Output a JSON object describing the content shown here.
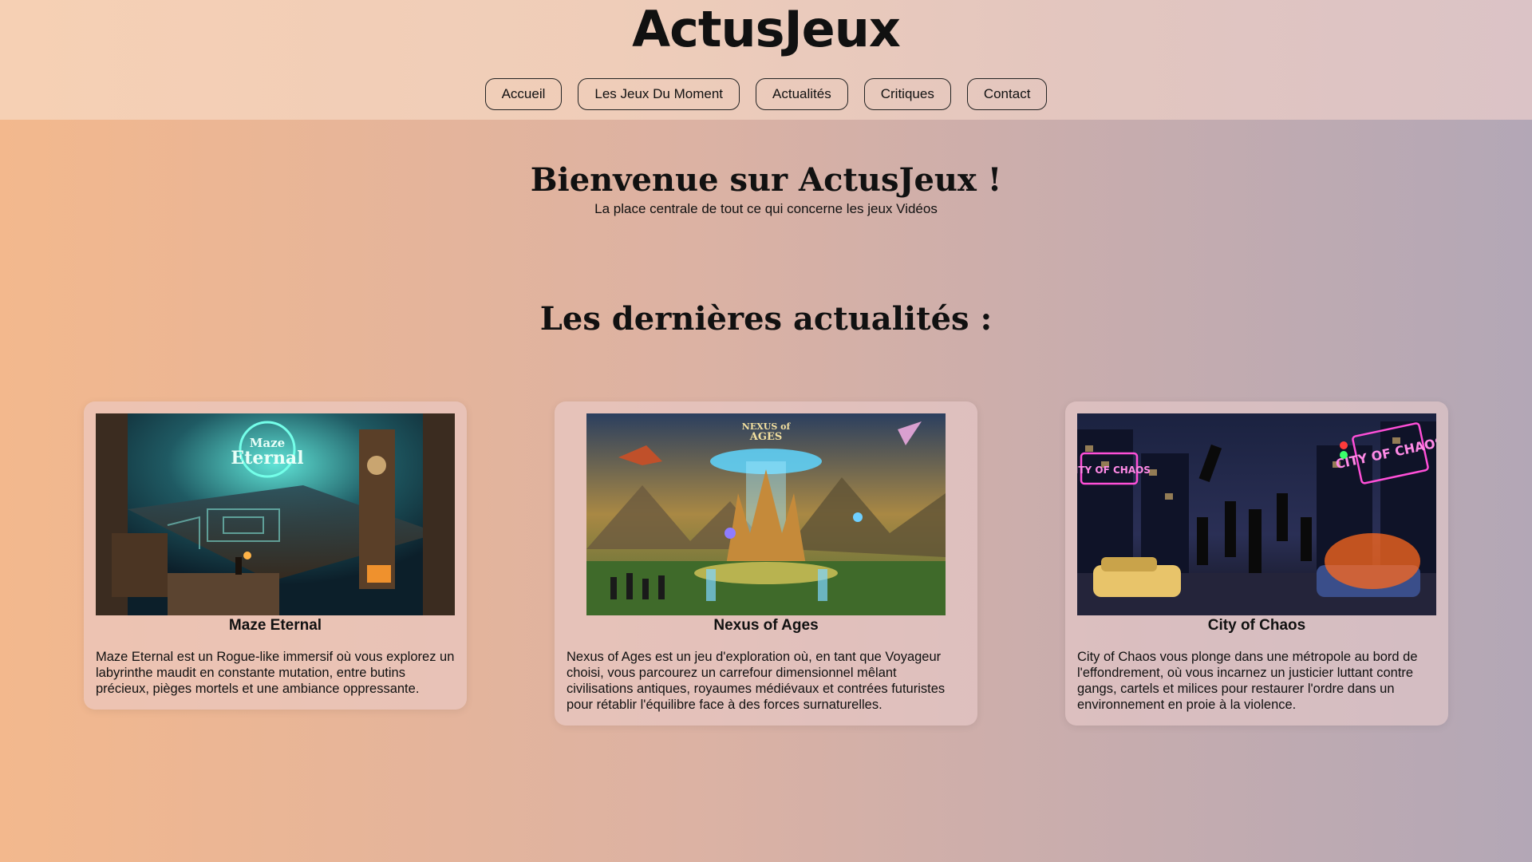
{
  "header": {
    "logo": "ActusJeux",
    "nav": [
      {
        "label": "Accueil"
      },
      {
        "label": "Les Jeux Du Moment"
      },
      {
        "label": "Actualités"
      },
      {
        "label": "Critiques"
      },
      {
        "label": "Contact"
      }
    ]
  },
  "hero": {
    "title": "Bienvenue sur ActusJeux !",
    "subtitle": "La place centrale de tout ce qui concerne les jeux Vidéos"
  },
  "news": {
    "title": "Les dernières actualités :",
    "cards": [
      {
        "name": "Maze Eternal",
        "image_logo_text": "Maze Eternal",
        "description": "Maze Eternal est un Rogue-like immersif où vous explorez un labyrinthe maudit en constante mutation, entre butins précieux, pièges mortels et une ambiance oppressante."
      },
      {
        "name": "Nexus of Ages",
        "image_logo_text": "Nexus of Ages",
        "description": "Nexus of Ages est un jeu d'exploration où, en tant que Voyageur choisi, vous parcourez un carrefour dimensionnel mêlant civilisations antiques, royaumes médiévaux et contrées futuristes pour rétablir l'équilibre face à des forces surnaturelles."
      },
      {
        "name": "City of Chaos",
        "image_logo_text": "City of Chaos",
        "description": "City of Chaos vous plonge dans une métropole au bord de l'effondrement, où vous incarnez un justicier luttant contre gangs, cartels et milices pour restaurer l'ordre dans un environnement en proie à la violence."
      }
    ]
  },
  "colors": {
    "background_left": "#f3b88d",
    "background_right": "#b3a7b6",
    "text": "#111111"
  }
}
